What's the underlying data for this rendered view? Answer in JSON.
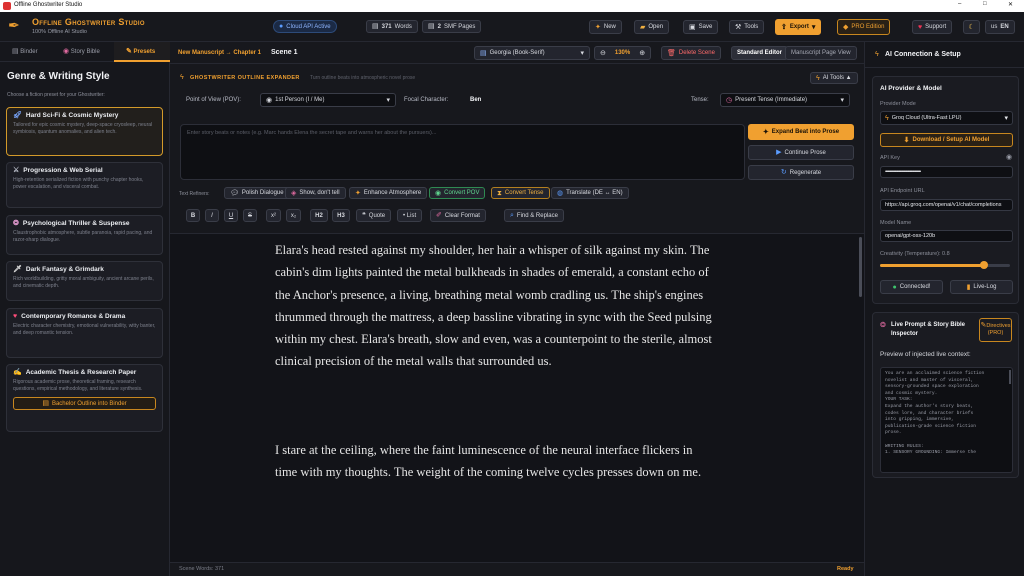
{
  "window": {
    "title": "Offline Ghostwriter Studio",
    "minimize": "–",
    "maximize": "□",
    "close": "✕"
  },
  "app": {
    "name": "Offline Ghostwriter Studio",
    "subtitle": "100% Offline AI Studio"
  },
  "header": {
    "api_status": "Cloud API Active",
    "words": "371",
    "words_label": "Words",
    "pages": "2",
    "pages_label": "SMF Pages",
    "new": "New",
    "open": "Open",
    "save": "Save",
    "tools": "Tools",
    "export": "Export",
    "pro": "PRO Edition",
    "support": "Support",
    "lang": "EN",
    "lang_flag": "us"
  },
  "left": {
    "tabs": [
      "Binder",
      "Story Bible",
      "Presets"
    ],
    "heading": "Genre & Writing Style",
    "subheading": "Choose a fiction preset for your Ghostwriter:",
    "presets": [
      {
        "icon": "rocket-icon",
        "title": "Hard Sci-Fi & Cosmic Mystery",
        "desc": "Tailored for epic cosmic mystery, deep-space cryosleep, neural symbiosis, quantum anomalies, and alien tech."
      },
      {
        "icon": "swords-icon",
        "title": "Progression & Web Serial",
        "desc": "High-retention serialized fiction with punchy chapter hooks, power escalation, and visceral combat."
      },
      {
        "icon": "brain-icon",
        "title": "Psychological Thriller & Suspense",
        "desc": "Claustrophobic atmosphere, subtle paranoia, rapid pacing, and razor-sharp dialogue."
      },
      {
        "icon": "dagger-icon",
        "title": "Dark Fantasy & Grimdark",
        "desc": "Rich worldbuilding, gritty moral ambiguity, ancient arcane perils, and cinematic depth."
      },
      {
        "icon": "heart-icon",
        "title": "Contemporary Romance & Drama",
        "desc": "Electric character chemistry, emotional vulnerability, witty banter, and deep romantic tension."
      },
      {
        "icon": "scroll-icon",
        "title": "Academic Thesis & Research Paper",
        "desc": "Rigorous academic prose, theoretical framing, research questions, empirical methodology, and literature synthesis."
      }
    ],
    "outline_btn": "Bachelor Outline into Binder"
  },
  "editor": {
    "breadcrumb": "New Manuscript → Chapter 1",
    "scene": "Scene 1",
    "font": "Georgia (Book-Serif)",
    "zoom": "130%",
    "delete": "Delete Scene",
    "mode_standard": "Standard Editor",
    "mode_manuscript": "Manuscript Page View",
    "expander_title": "GHOSTWRITER OUTLINE EXPANDER",
    "expander_hint": "Turn outline beats into atmospheric novel prose",
    "ai_tools": "AI Tools ▲",
    "pov_label": "Point of View (POV):",
    "pov_value": "1st Person (I / Me)",
    "focal_label": "Focal Character:",
    "focal_value": "Ben",
    "tense_label": "Tense:",
    "tense_value": "Present Tense (Immediate)",
    "beat_placeholder": "Enter story beats or notes (e.g. Marc hands Elena the secret tape and warns her about the pursuers)...",
    "expand_btn": "Expand Beat into Prose",
    "continue_btn": "Continue Prose",
    "regenerate_btn": "Regenerate",
    "refiners_label": "Text Refiners:",
    "refiners": [
      "Polish Dialogue",
      "Show, don't tell",
      "Enhance Atmosphere",
      "Convert POV",
      "Convert Tense",
      "Translate (DE ↔ EN)"
    ],
    "format": [
      "B",
      "I",
      "U",
      "S",
      "x²",
      "x₂",
      "H2",
      "H3",
      "Quote",
      "• List",
      "Clear Format",
      "Find & Replace"
    ],
    "paragraphs": [
      [
        "Elara's head rested against my shoulder, her hair a whisper of silk against my skin. The",
        "cabin's dim lights painted the metal bulkheads in shades of emerald, a constant echo of",
        "the Anchor's presence, a living, breathing metal womb cradling us. The ship's engines",
        "thrummed through the mattress, a deep bassline vibrating in sync with the Seed pulsing",
        "within my chest. Elara's breath, slow and even, was a counterpoint to the sterile, almost",
        "clinical precision of the metal walls that surrounded us."
      ],
      [
        "I stare at the ceiling, where the faint luminescence of the neural interface flickers in",
        "time with my thoughts. The weight of the coming twelve cycles presses down on me."
      ]
    ],
    "status_words": "Scene Words: 371",
    "status_state": "Ready"
  },
  "right": {
    "title": "AI Connection & Setup",
    "provider_heading": "AI Provider & Model",
    "provider_mode_label": "Provider Mode",
    "provider_mode": "Groq Cloud (Ultra-Fast LPU)",
    "download_btn": "Download / Setup AI Model",
    "api_key_label": "API Key",
    "api_key_value": "••••••••••••••••••••••••••••••••••••••",
    "endpoint_label": "API Endpoint URL",
    "endpoint_value": "https://api.groq.com/openai/v1/chat/completions",
    "model_label": "Model Name",
    "model_value": "openai/gpt-oss-120b",
    "creativity_label": "Creativity (Temperature): 0.8",
    "creativity": 0.8,
    "connected": "Connected!",
    "livelog": "Live-Log",
    "live_title": "Live Prompt & Story Bible Inspector",
    "directives": "Directives (PRO)",
    "preview_label": "Preview of injected live context:",
    "preview_lines": [
      "You are an acclaimed science fiction",
      "novelist and master of visceral,",
      "sensory-grounded space exploration",
      "and cosmic mystery.",
      "YOUR TASK:",
      "Expand the author's story beats,",
      "codes lore, and character briefs",
      "into gripping, immersive,",
      "publication-grade science fiction",
      "prose.",
      "",
      "WRITING RULES:",
      "1. SENSORY GROUNDING: Immerse the"
    ]
  },
  "colors": {
    "accent": "#f0a030",
    "bg": "#121318",
    "panel": "#17181d",
    "green": "#3ec46d"
  }
}
